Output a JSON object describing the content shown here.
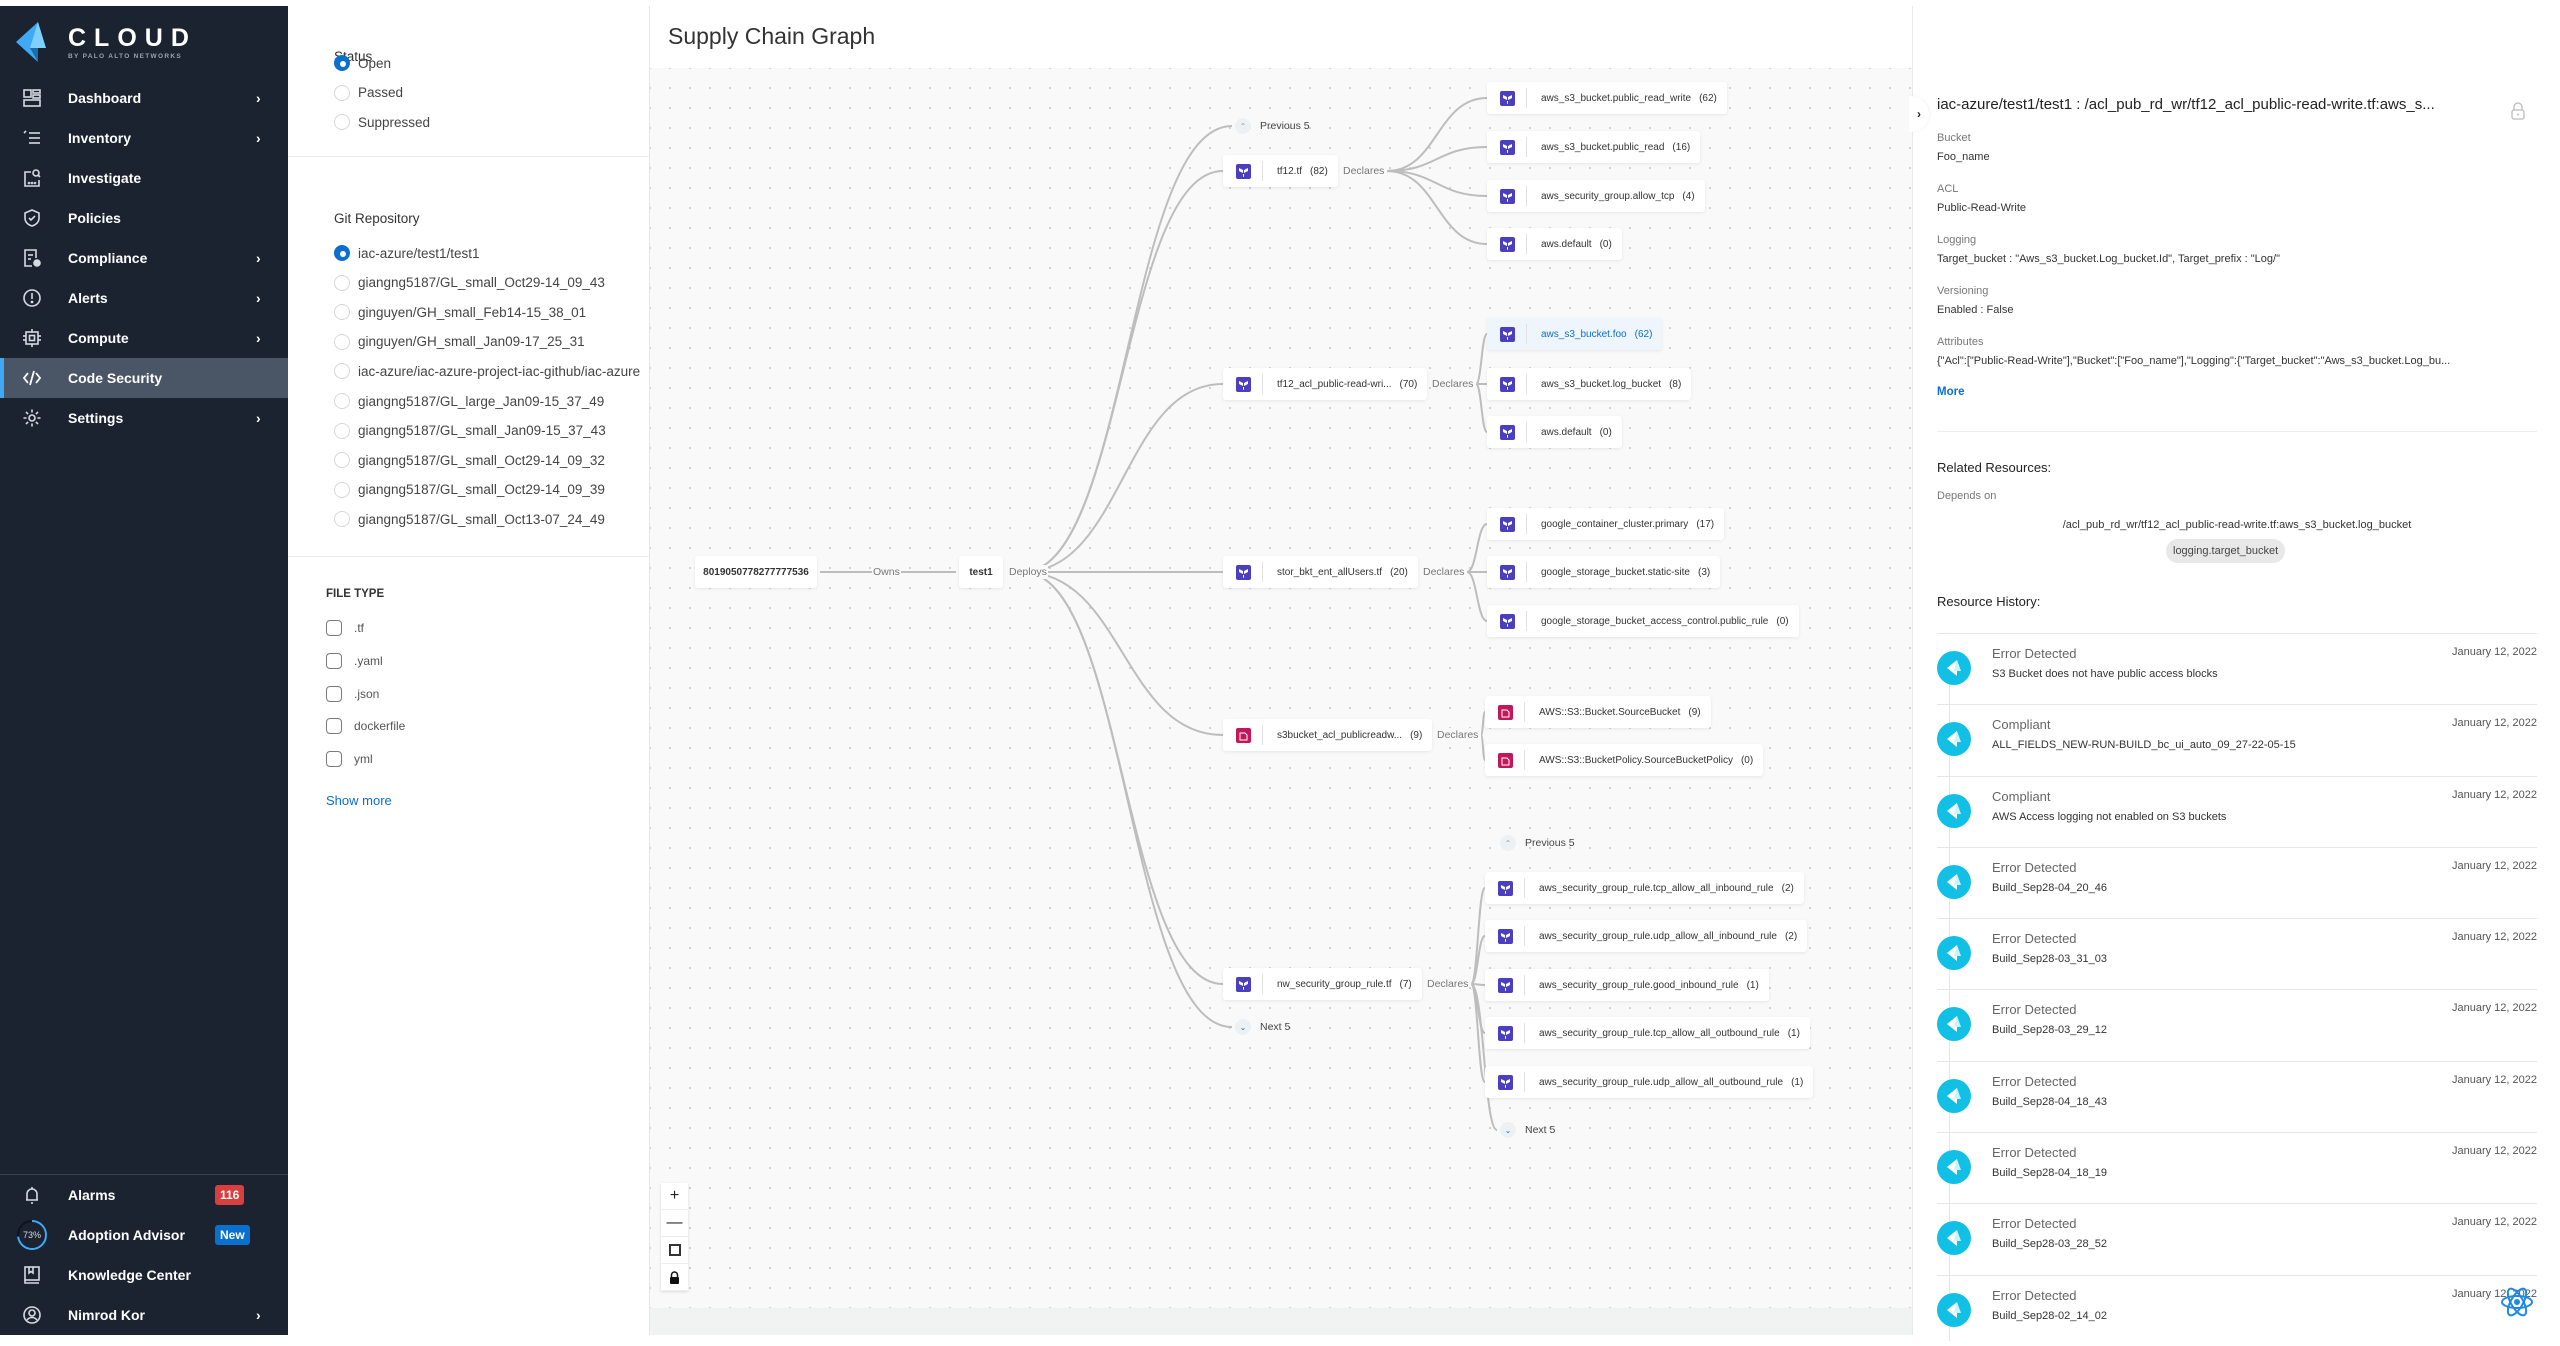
{
  "brand": {
    "name": "CLOUD",
    "tagline": "BY PALO ALTO NETWORKS",
    "accent": "#3fa9f5"
  },
  "sidebar": {
    "items": [
      {
        "label": "Dashboard",
        "icon": "dashboard-icon",
        "chevron": true
      },
      {
        "label": "Inventory",
        "icon": "inventory-icon",
        "chevron": true
      },
      {
        "label": "Investigate",
        "icon": "investigate-icon",
        "chevron": false
      },
      {
        "label": "Policies",
        "icon": "shield-check-icon",
        "chevron": false
      },
      {
        "label": "Compliance",
        "icon": "compliance-icon",
        "chevron": true
      },
      {
        "label": "Alerts",
        "icon": "alert-icon",
        "chevron": true
      },
      {
        "label": "Compute",
        "icon": "chip-icon",
        "chevron": true
      },
      {
        "label": "Code Security",
        "icon": "code-icon",
        "chevron": false,
        "active": true
      },
      {
        "label": "Settings",
        "icon": "gear-icon",
        "chevron": true
      }
    ],
    "bottom": {
      "alarms": {
        "label": "Alarms",
        "badge": "116",
        "badge_color": "#d93f3f"
      },
      "adoption": {
        "label": "Adoption Advisor",
        "progress_percent": 73,
        "progress_text": "73%",
        "badge": "New",
        "badge_color": "#0b6fce"
      },
      "knowledge": {
        "label": "Knowledge Center"
      },
      "user": {
        "label": "Nimrod Kor"
      }
    },
    "collapse_glyph": "‹"
  },
  "filters": {
    "status": {
      "title": "Status",
      "options": [
        {
          "label": "Open",
          "checked": true
        },
        {
          "label": "Passed",
          "checked": false
        },
        {
          "label": "Suppressed",
          "checked": false
        }
      ]
    },
    "git_repository": {
      "title": "Git Repository",
      "options": [
        {
          "label": "iac-azure/test1/test1",
          "checked": true
        },
        {
          "label": "giangng5187/GL_small_Oct29-14_09_43",
          "checked": false
        },
        {
          "label": "ginguyen/GH_small_Feb14-15_38_01",
          "checked": false
        },
        {
          "label": "ginguyen/GH_small_Jan09-17_25_31",
          "checked": false
        },
        {
          "label": "iac-azure/iac-azure-project-iac-github/iac-azure",
          "checked": false
        },
        {
          "label": "giangng5187/GL_large_Jan09-15_37_49",
          "checked": false
        },
        {
          "label": "giangng5187/GL_small_Jan09-15_37_43",
          "checked": false
        },
        {
          "label": "giangng5187/GL_small_Oct29-14_09_32",
          "checked": false
        },
        {
          "label": "giangng5187/GL_small_Oct29-14_09_39",
          "checked": false
        },
        {
          "label": "giangng5187/GL_small_Oct13-07_24_49",
          "checked": false
        }
      ]
    },
    "file_type": {
      "title": "FILE TYPE",
      "options": [
        {
          "label": ".tf",
          "checked": false
        },
        {
          "label": ".yaml",
          "checked": false
        },
        {
          "label": ".json",
          "checked": false
        },
        {
          "label": "dockerfile",
          "checked": false
        },
        {
          "label": "yml",
          "checked": false
        }
      ],
      "show_more": "Show more"
    }
  },
  "graph": {
    "title": "Supply Chain Graph",
    "root": {
      "account": "8019050778277777536",
      "owns_label": "Owns",
      "repo": "test1",
      "deploys_label": "Deploys"
    },
    "pager": {
      "previous": "Previous 5",
      "next": "Next 5"
    },
    "files": [
      {
        "name": "tf12.tf",
        "count": "(82)",
        "type": "terraform",
        "edge": "Declares",
        "resources": [
          {
            "name": "aws_s3_bucket.public_read_write",
            "count": "(62)"
          },
          {
            "name": "aws_s3_bucket.public_read",
            "count": "(16)"
          },
          {
            "name": "aws_security_group.allow_tcp",
            "count": "(4)"
          },
          {
            "name": "aws.default",
            "count": "(0)"
          }
        ]
      },
      {
        "name": "tf12_acl_public-read-wri...",
        "count": "(70)",
        "type": "terraform",
        "edge": "Declares",
        "resources": [
          {
            "name": "aws_s3_bucket.foo",
            "count": "(62)",
            "selected": true
          },
          {
            "name": "aws_s3_bucket.log_bucket",
            "count": "(8)"
          },
          {
            "name": "aws.default",
            "count": "(0)"
          }
        ]
      },
      {
        "name": "stor_bkt_ent_allUsers.tf",
        "count": "(20)",
        "type": "terraform",
        "edge": "Declares",
        "resources": [
          {
            "name": "google_container_cluster.primary",
            "count": "(17)"
          },
          {
            "name": "google_storage_bucket.static-site",
            "count": "(3)"
          },
          {
            "name": "google_storage_bucket_access_control.public_rule",
            "count": "(0)"
          }
        ]
      },
      {
        "name": "s3bucket_acl_publicreadw...",
        "count": "(9)",
        "type": "cloudformation",
        "edge": "Declares",
        "resources": [
          {
            "name": "AWS::S3::Bucket.SourceBucket",
            "count": "(9)"
          },
          {
            "name": "AWS::S3::BucketPolicy.SourceBucketPolicy",
            "count": "(0)"
          }
        ]
      },
      {
        "name": "nw_security_group_rule.tf",
        "count": "(7)",
        "type": "terraform",
        "edge": "Declares",
        "resources": [
          {
            "name": "aws_security_group_rule.tcp_allow_all_inbound_rule",
            "count": "(2)"
          },
          {
            "name": "aws_security_group_rule.udp_allow_all_inbound_rule",
            "count": "(2)"
          },
          {
            "name": "aws_security_group_rule.good_inbound_rule",
            "count": "(1)"
          },
          {
            "name": "aws_security_group_rule.tcp_allow_all_outbound_rule",
            "count": "(1)"
          },
          {
            "name": "aws_security_group_rule.udp_allow_all_outbound_rule",
            "count": "(1)"
          }
        ]
      }
    ],
    "zoom_controls": {
      "zoom_in": "+",
      "zoom_out": "—",
      "fit": "⛶",
      "lock": "🔒"
    }
  },
  "detail": {
    "title": "iac-azure/test1/test1 : /acl_pub_rd_wr/tf12_acl_public-read-write.tf:aws_s...",
    "attributes": [
      {
        "label": "Bucket",
        "value": "Foo_name"
      },
      {
        "label": "ACL",
        "value": "Public-Read-Write"
      },
      {
        "label": "Logging",
        "value": "Target_bucket : \"Aws_s3_bucket.Log_bucket.Id\", Target_prefix : \"Log/\""
      },
      {
        "label": "Versioning",
        "value": "Enabled : False"
      },
      {
        "label": "Attributes",
        "value": "{\"Acl\":[\"Public-Read-Write\"],\"Bucket\":[\"Foo_name\"],\"Logging\":{\"Target_bucket\":\"Aws_s3_bucket.Log_bu..."
      }
    ],
    "more": "More",
    "related": {
      "title": "Related Resources:",
      "depends_on_label": "Depends on",
      "path": "/acl_pub_rd_wr/tf12_acl_public-read-write.tf:aws_s3_bucket.log_bucket",
      "chip": "logging.target_bucket"
    },
    "history": {
      "title": "Resource History:",
      "entries": [
        {
          "status": "Error Detected",
          "desc": "S3 Bucket does not have public access blocks",
          "date": "January 12, 2022"
        },
        {
          "status": "Compliant",
          "desc": "ALL_FIELDS_NEW-RUN-BUILD_bc_ui_auto_09_27-22-05-15",
          "date": "January 12, 2022"
        },
        {
          "status": "Compliant",
          "desc": "AWS Access logging not enabled on S3 buckets",
          "date": "January 12, 2022"
        },
        {
          "status": "Error Detected",
          "desc": "Build_Sep28-04_20_46",
          "date": "January 12, 2022"
        },
        {
          "status": "Error Detected",
          "desc": "Build_Sep28-03_31_03",
          "date": "January 12, 2022"
        },
        {
          "status": "Error Detected",
          "desc": "Build_Sep28-03_29_12",
          "date": "January 12, 2022"
        },
        {
          "status": "Error Detected",
          "desc": "Build_Sep28-04_18_43",
          "date": "January 12, 2022"
        },
        {
          "status": "Error Detected",
          "desc": "Build_Sep28-04_18_19",
          "date": "January 12, 2022"
        },
        {
          "status": "Error Detected",
          "desc": "Build_Sep28-03_28_52",
          "date": "January 12, 2022"
        },
        {
          "status": "Error Detected",
          "desc": "Build_Sep28-02_14_02",
          "date": "January 12, 2022"
        }
      ]
    }
  }
}
